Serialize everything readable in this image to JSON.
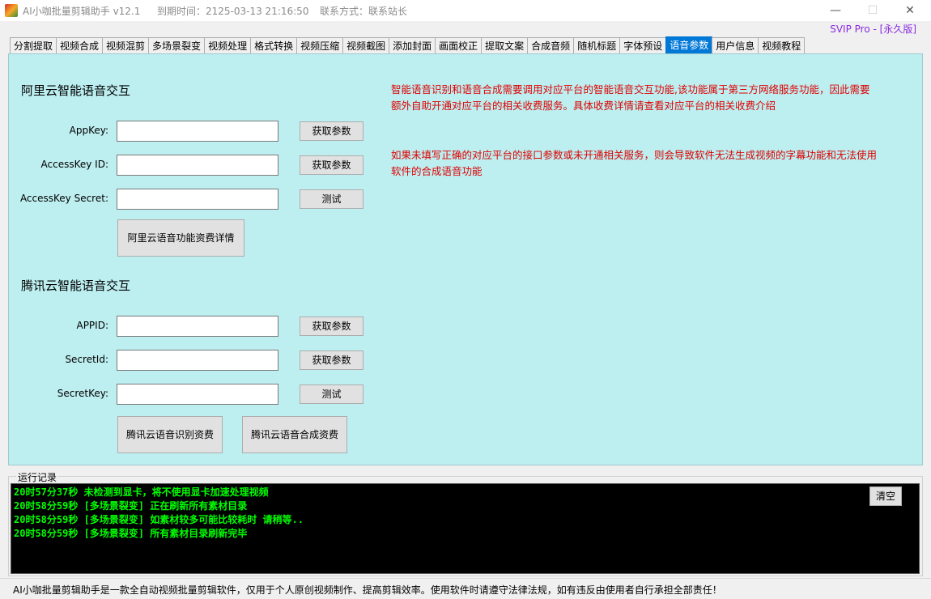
{
  "window": {
    "app_name": "AI小咖批量剪辑助手 v12.1",
    "expiry": "到期时间：2125-03-13 21:16:50",
    "contact": "联系方式：联系站长",
    "minimize": "—",
    "maximize": "☐",
    "close": "✕"
  },
  "svip": "SVIP Pro - [永久版]",
  "tabs": [
    {
      "label": "分割提取",
      "active": false
    },
    {
      "label": "视频合成",
      "active": false
    },
    {
      "label": "视频混剪",
      "active": false
    },
    {
      "label": "多场景裂变",
      "active": false
    },
    {
      "label": "视频处理",
      "active": false
    },
    {
      "label": "格式转换",
      "active": false
    },
    {
      "label": "视频压缩",
      "active": false
    },
    {
      "label": "视频截图",
      "active": false
    },
    {
      "label": "添加封面",
      "active": false
    },
    {
      "label": "画面校正",
      "active": false
    },
    {
      "label": "提取文案",
      "active": false
    },
    {
      "label": "合成音频",
      "active": false
    },
    {
      "label": "随机标题",
      "active": false
    },
    {
      "label": "字体预设",
      "active": false
    },
    {
      "label": "语音参数",
      "active": true
    },
    {
      "label": "用户信息",
      "active": false
    },
    {
      "label": "视频教程",
      "active": false
    }
  ],
  "aliyun": {
    "title": "阿里云智能语音交互",
    "appkey_label": "AppKey:",
    "appkey_value": "",
    "akid_label": "AccessKey ID:",
    "akid_value": "",
    "secret_label": "AccessKey Secret:",
    "secret_value": "",
    "get_params_1": "获取参数",
    "get_params_2": "获取参数",
    "test": "测试",
    "pricing": "阿里云语音功能资费详情"
  },
  "tencent": {
    "title": "腾讯云智能语音交互",
    "appid_label": "APPID:",
    "appid_value": "",
    "secretid_label": "SecretId:",
    "secretid_value": "",
    "secretkey_label": "SecretKey:",
    "secretkey_value": "",
    "get_params_1": "获取参数",
    "get_params_2": "获取参数",
    "test": "测试",
    "asr_pricing": "腾讯云语音识别资费",
    "tts_pricing": "腾讯云语音合成资费"
  },
  "notice": {
    "para1": "智能语音识别和语音合成需要调用对应平台的智能语音交互功能,该功能属于第三方网络服务功能，因此需要额外自助开通对应平台的相关收费服务。具体收费详情请查看对应平台的相关收费介绍",
    "para2": "如果未填写正确的对应平台的接口参数或未开通相关服务，则会导致软件无法生成视频的字幕功能和无法使用软件的合成语音功能"
  },
  "log": {
    "legend": "运行记录",
    "clear": "清空",
    "lines": [
      "20时57分37秒 未检测到显卡，将不使用显卡加速处理视频",
      "20时58分59秒 [多场景裂变] 正在刷新所有素材目录",
      "20时58分59秒 [多场景裂变] 如素材较多可能比较耗时 请稍等..",
      "20时58分59秒 [多场景裂变] 所有素材目录刷新完毕"
    ]
  },
  "status": "AI小咖批量剪辑助手是一款全自动视频批量剪辑软件，仅用于个人原创视频制作、提高剪辑效率。使用软件时请遵守法律法规，如有违反由使用者自行承担全部责任！"
}
